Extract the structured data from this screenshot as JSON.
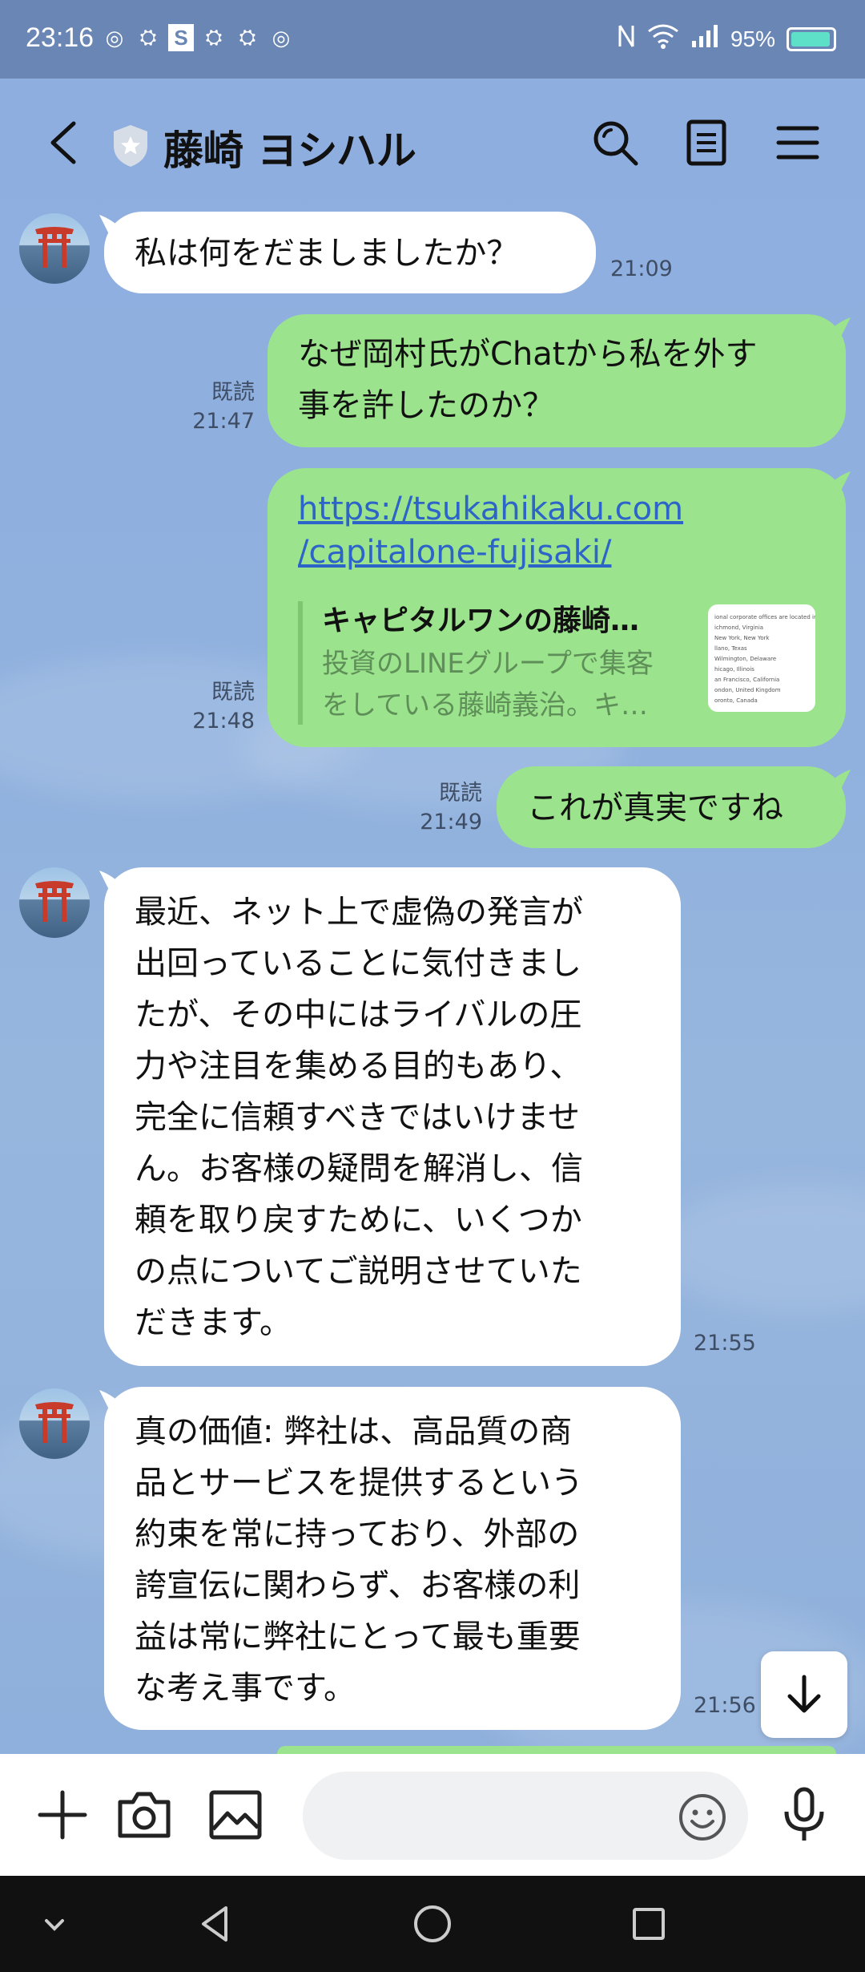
{
  "status": {
    "time": "23:16",
    "battery": "95%"
  },
  "header": {
    "title": "藤崎 ヨシハル"
  },
  "messages": [
    {
      "side": "in",
      "text": "私は何をだましましたか？",
      "time": "21:09"
    },
    {
      "side": "out",
      "text_lines": [
        "なぜ岡村氏がChatから私を外す",
        "事を許したのか？"
      ],
      "read": "既読",
      "time": "21:47"
    },
    {
      "side": "out",
      "read": "既読",
      "time": "21:48",
      "url_lines": [
        "https://tsukahikaku.com",
        "/capitalone-fujisaki/"
      ],
      "preview_title": "キャピタルワンの藤崎…",
      "preview_desc_lines": [
        "投資のLINEグループで集客",
        "をしている藤崎義治。キ…"
      ],
      "thumb_lines": [
        "ional corporate offices are located in:",
        "ichmond, Virginia",
        "New York, New York",
        "llano, Texas",
        "Wilmington, Delaware",
        "hicago, Illinois",
        "an Francisco, California",
        "ondon, United Kingdom",
        "oronto, Canada"
      ]
    },
    {
      "side": "out",
      "text": "これが真実ですね",
      "read": "既読",
      "time": "21:49"
    },
    {
      "side": "in",
      "text_lines": [
        "最近、ネット上で虚偽の発言が",
        "出回っていることに気付きまし",
        "たが、その中にはライバルの圧",
        "力や注目を集める目的もあり、",
        "完全に信頼すべきではいけませ",
        "ん。お客様の疑問を解消し、信",
        "頼を取り戻すために、いくつか",
        "の点についてご説明させていた",
        "だきます。"
      ],
      "time": "21:55"
    },
    {
      "side": "in",
      "text_lines": [
        "真の価値: 弊社は、高品質の商",
        "品とサービスを提供するという",
        "約束を常に持っており、外部の",
        "誇宣伝に関わらず、お客様の利",
        "益は常に弊社にとって最も重要",
        "な考え事です。"
      ],
      "time": "21:56"
    }
  ],
  "input": {
    "placeholder": ""
  },
  "icons": {
    "back": "back-arrow-icon",
    "shield": "shield-star-icon",
    "search": "search-icon",
    "notes": "notes-icon",
    "menu": "menu-icon",
    "plus": "plus-icon",
    "camera": "camera-icon",
    "image": "image-icon",
    "emoji": "emoji-icon",
    "mic": "microphone-icon",
    "scroll_down": "arrow-down-icon"
  },
  "colors": {
    "outgoing_bubble": "#9be38c",
    "incoming_bubble": "#ffffff",
    "status_bar": "#6a86b5",
    "chat_bg": "#8fb0dc",
    "link": "#2d64c9"
  }
}
